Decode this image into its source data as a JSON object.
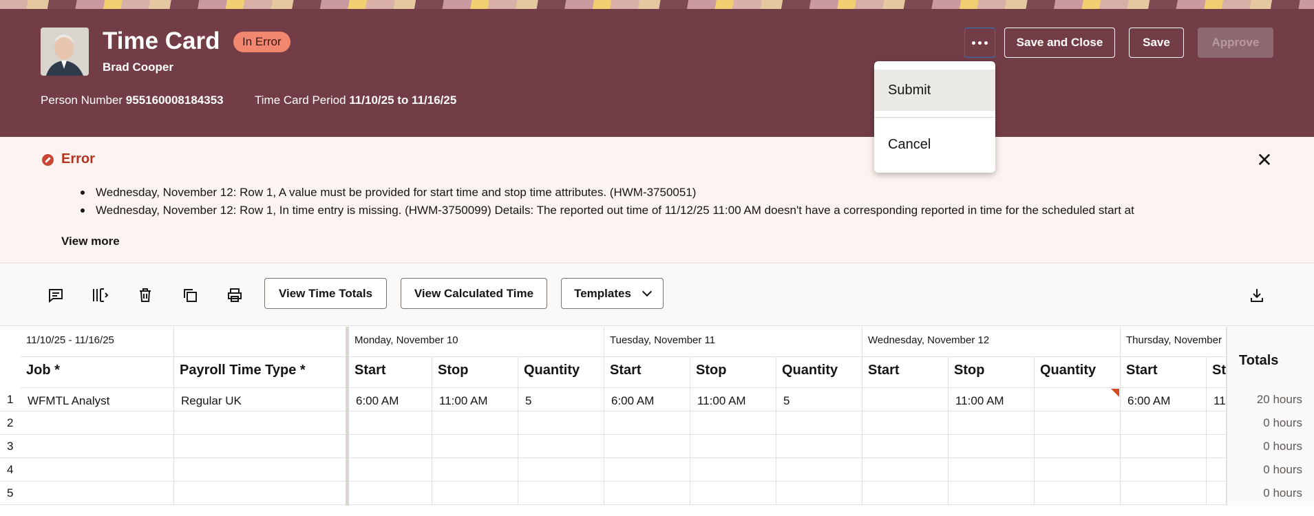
{
  "header": {
    "title": "Time Card",
    "status_badge": "In Error",
    "person_name": "Brad Cooper",
    "person_number_label": "Person Number",
    "person_number": "955160008184353",
    "period_label": "Time Card Period",
    "period_value": "11/10/25 to 11/16/25",
    "actions": {
      "save_and_close": "Save and Close",
      "save": "Save",
      "approve": "Approve"
    }
  },
  "more_menu": {
    "items": [
      "Submit",
      "Cancel"
    ],
    "highlighted": "Submit"
  },
  "error_panel": {
    "title": "Error",
    "messages": [
      "Wednesday, November 12: Row 1, A value must be provided for start time and stop time attributes. (HWM-3750051)",
      "Wednesday, November 12: Row 1, In time entry is missing. (HWM-3750099) Details: The reported out time of 11/12/25 11:00 AM doesn't have a corresponding reported in time for the scheduled start at"
    ],
    "view_more": "View more"
  },
  "toolbar": {
    "icons": [
      "comment-icon",
      "add-column-icon",
      "delete-icon",
      "duplicate-icon",
      "print-icon"
    ],
    "view_time_totals": "View Time Totals",
    "view_calculated_time": "View Calculated Time",
    "templates": "Templates",
    "download_icon": "download-icon"
  },
  "grid": {
    "range_label": "11/10/25 - 11/16/25",
    "days": [
      "Monday, November 10",
      "Tuesday, November 11",
      "Wednesday, November 12",
      "Thursday, November"
    ],
    "columns": [
      "Job *",
      "Payroll Time Type *",
      "Start",
      "Stop",
      "Quantity",
      "Totals"
    ],
    "partial_column": "St",
    "rows": [
      {
        "num": "1",
        "job": "WFMTL Analyst",
        "type": "Regular UK",
        "mon": [
          "6:00 AM",
          "11:00 AM",
          "5"
        ],
        "tue": [
          "6:00 AM",
          "11:00 AM",
          "5"
        ],
        "wed": [
          "",
          "11:00 AM",
          ""
        ],
        "thu_start": "6:00 AM",
        "thu_stop_partial": "11",
        "total": "20 hours"
      },
      {
        "num": "2",
        "total": "0 hours"
      },
      {
        "num": "3",
        "total": "0 hours"
      },
      {
        "num": "4",
        "total": "0 hours"
      },
      {
        "num": "5",
        "total": "0 hours"
      }
    ]
  },
  "colors": {
    "banner": "#733d47",
    "badge": "#f2876f",
    "error_accent": "#c74634",
    "error_bg": "#fdf3f0"
  }
}
